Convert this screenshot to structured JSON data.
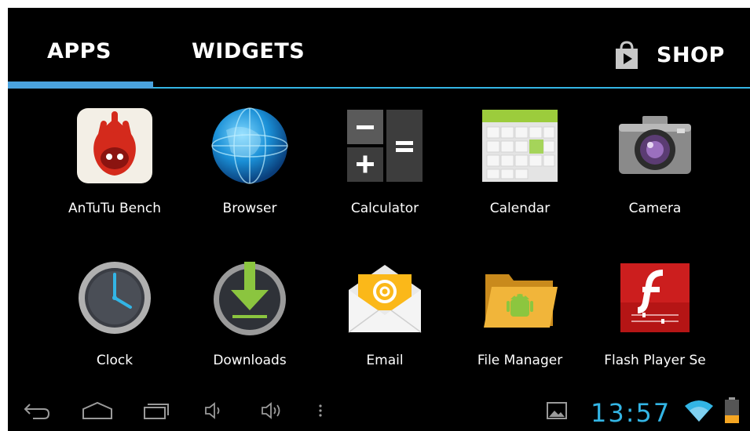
{
  "tabs": {
    "apps": "APPS",
    "widgets": "WIDGETS",
    "shop": "SHOP"
  },
  "apps": [
    {
      "label": "AnTuTu Bench",
      "icon": "antutu-icon"
    },
    {
      "label": "Browser",
      "icon": "globe-icon"
    },
    {
      "label": "Calculator",
      "icon": "calculator-icon"
    },
    {
      "label": "Calendar",
      "icon": "calendar-icon"
    },
    {
      "label": "Camera",
      "icon": "camera-icon"
    },
    {
      "label": "Clock",
      "icon": "clock-icon"
    },
    {
      "label": "Downloads",
      "icon": "download-icon"
    },
    {
      "label": "Email",
      "icon": "email-icon"
    },
    {
      "label": "File Manager",
      "icon": "folder-icon"
    },
    {
      "label": "Flash Player Se",
      "icon": "flash-icon"
    }
  ],
  "status": {
    "time": "13:57"
  },
  "colors": {
    "accent": "#33b5e5",
    "indicator": "#4aa3df",
    "background": "#000000"
  }
}
